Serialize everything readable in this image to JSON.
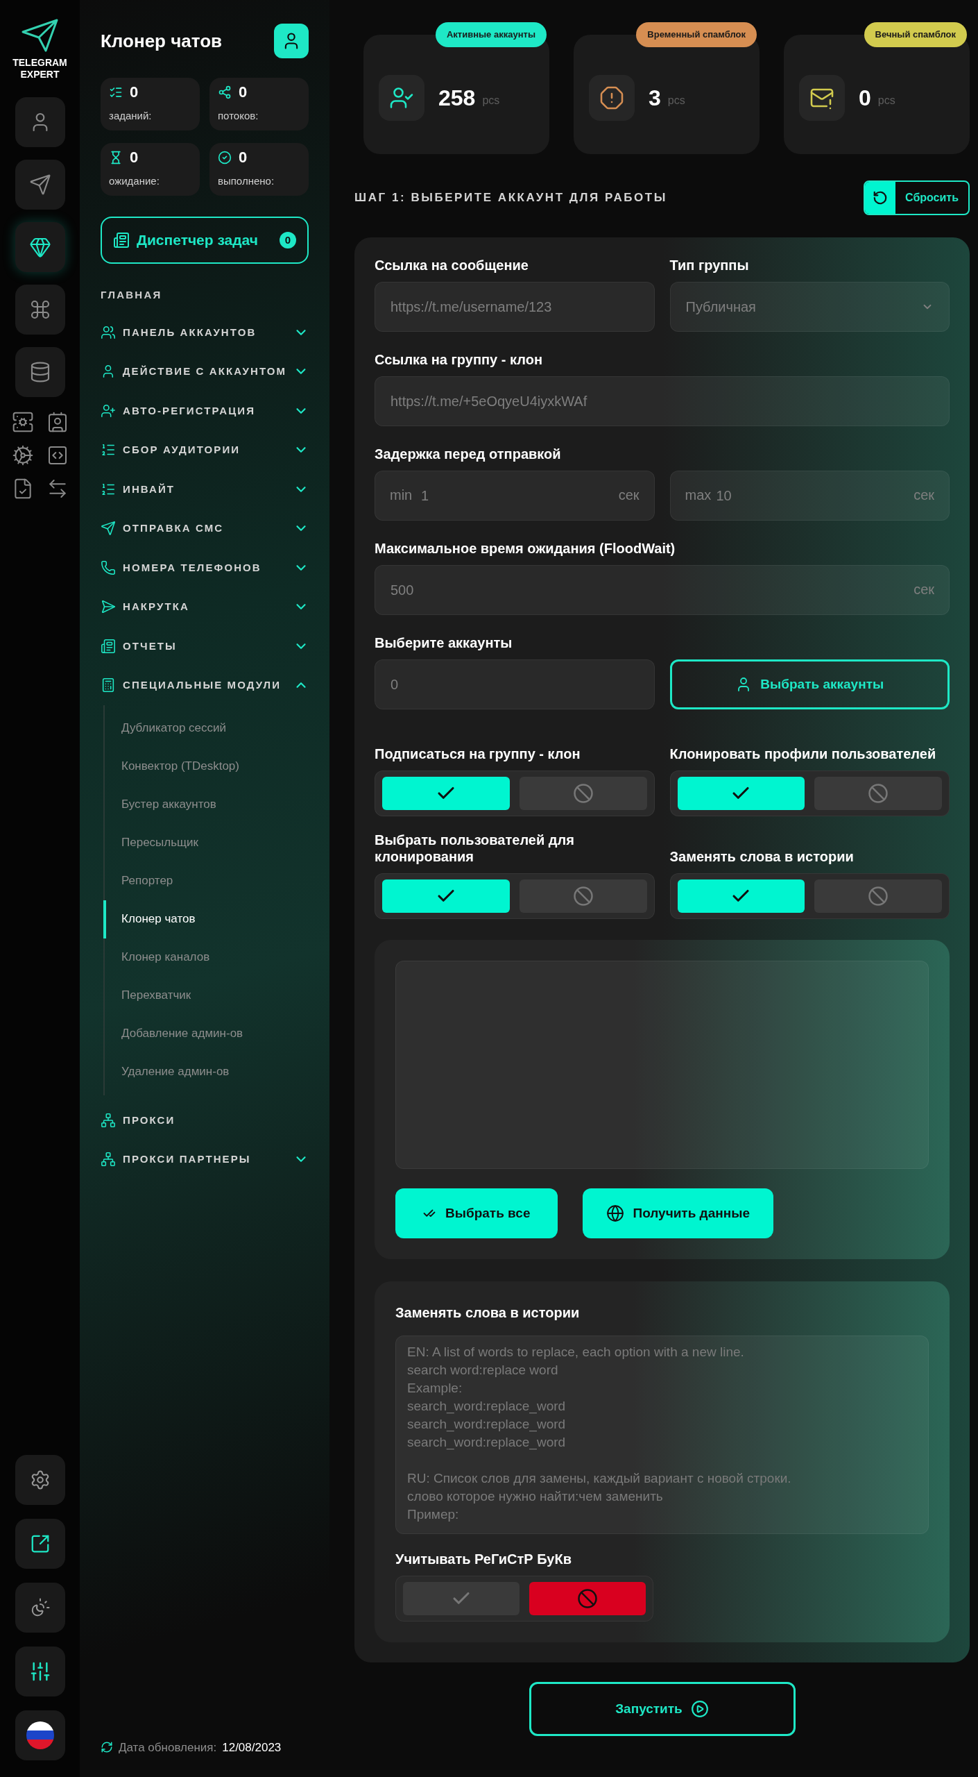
{
  "rail": {
    "logo": [
      "TELEGRAM",
      "EXPERT"
    ],
    "items": [
      {
        "selected": false
      },
      {
        "selected": false
      },
      {
        "selected": true
      },
      {
        "selected": false
      },
      {
        "selected": false
      }
    ]
  },
  "sidebar": {
    "title": "Клонер чатов",
    "counters": [
      {
        "value": "0",
        "label": "заданий:"
      },
      {
        "value": "0",
        "label": "потоков:"
      },
      {
        "value": "0",
        "label": "ожидание:"
      },
      {
        "value": "0",
        "label": "выполнено:"
      }
    ],
    "task_manager": {
      "label": "Диспетчер задач",
      "count": "0"
    },
    "heading": "ГЛАВНАЯ",
    "nav": [
      {
        "label": "ПАНЕЛЬ АККАУНТОВ",
        "kind": "group",
        "expanded": false
      },
      {
        "label": "ДЕЙСТВИЕ С АККАУНТОМ",
        "kind": "group",
        "expanded": false
      },
      {
        "label": "АВТО-РЕГИСТРАЦИЯ",
        "kind": "group",
        "expanded": false
      },
      {
        "label": "СБОР АУДИТОРИИ",
        "kind": "group",
        "expanded": false
      },
      {
        "label": "ИНВАЙТ",
        "kind": "group",
        "expanded": false
      },
      {
        "label": "ОТПРАВКА СМС",
        "kind": "group",
        "expanded": false
      },
      {
        "label": "НОМЕРА ТЕЛЕФОНОВ",
        "kind": "group",
        "expanded": false
      },
      {
        "label": "НАКРУТКА",
        "kind": "group",
        "expanded": false
      },
      {
        "label": "ОТЧЕТЫ",
        "kind": "group",
        "expanded": false
      },
      {
        "label": "СПЕЦИАЛЬНЫЕ МОДУЛИ",
        "kind": "group",
        "expanded": true,
        "children": [
          {
            "label": "Дубликатор сессий",
            "selected": false
          },
          {
            "label": "Конвектор (TDesktop)",
            "selected": false
          },
          {
            "label": "Бустер аккаунтов",
            "selected": false
          },
          {
            "label": "Пересыльщик",
            "selected": false
          },
          {
            "label": "Репортер",
            "selected": false
          },
          {
            "label": "Клонер чатов",
            "selected": true
          },
          {
            "label": "Клонер каналов",
            "selected": false
          },
          {
            "label": "Перехватчик",
            "selected": false
          },
          {
            "label": "Добавление админ-ов",
            "selected": false
          },
          {
            "label": "Удаление админ-ов",
            "selected": false
          }
        ]
      },
      {
        "label": "ПРОКСИ",
        "kind": "link"
      },
      {
        "label": "ПРОКСИ ПАРТНЕРЫ",
        "kind": "group",
        "expanded": false
      }
    ],
    "footer": {
      "label": "Дата обновления:",
      "date": "12/08/2023"
    }
  },
  "stats": [
    {
      "badge": "Активные аккаунты",
      "value": "258",
      "unit": "pcs",
      "color": "#1ee8c6"
    },
    {
      "badge": "Временный спамблок",
      "value": "3",
      "unit": "pcs",
      "color": "#d68e52"
    },
    {
      "badge": "Вечный спамблок",
      "value": "0",
      "unit": "pcs",
      "color": "#d2cb4e"
    }
  ],
  "step_title": "ШАГ 1: ВЫБЕРИТЕ АККАУНТ ДЛЯ РАБОТЫ",
  "reset_button": "Сбросить",
  "form": {
    "message_link": {
      "label": "Ссылка на сообщение",
      "placeholder": "https://t.me/username/123"
    },
    "group_type": {
      "label": "Тип группы",
      "value": "Публичная"
    },
    "clone_link": {
      "label": "Ссылка на группу - клон",
      "placeholder": "https://t.me/+5eOqyeU4iyxkWAf"
    },
    "delay": {
      "label": "Задержка перед отправкой",
      "min": {
        "prefix": "min",
        "placeholder": "1",
        "unit": "сек"
      },
      "max": {
        "prefix": "max",
        "placeholder": "10",
        "unit": "сек"
      }
    },
    "flood_wait": {
      "label": "Максимальное время ожидания (FloodWait)",
      "placeholder": "500",
      "unit": "сек"
    },
    "accounts": {
      "label": "Выберите аккаунты",
      "placeholder": "0",
      "button": "Выбрать аккаунты"
    },
    "toggles": [
      {
        "label": "Подписаться на группу - клон",
        "on": true
      },
      {
        "label": "Клонировать профили пользователей",
        "on": true
      },
      {
        "label": "Выбрать пользователей для клонирования",
        "on": true
      },
      {
        "label": "Заменять слова в истории",
        "on": true
      }
    ]
  },
  "users_panel": {
    "select_all": "Выбрать все",
    "fetch": "Получить данные"
  },
  "replace_panel": {
    "title": "Заменять слова в истории",
    "placeholder": "EN: A list of words to replace, each option with a new line.\nsearch word:replace word\nExample:\nsearch_word:replace_word\nsearch_word:replace_word\nsearch_word:replace_word\n\nRU: Список слов для замены, каждый вариант с новой строки.\nслово которое нужно найти:чем заменить\nПример:",
    "case_toggle": {
      "label": "Учитывать РеГиСтР БуКв",
      "on": false
    }
  },
  "launch_button": "Запустить"
}
